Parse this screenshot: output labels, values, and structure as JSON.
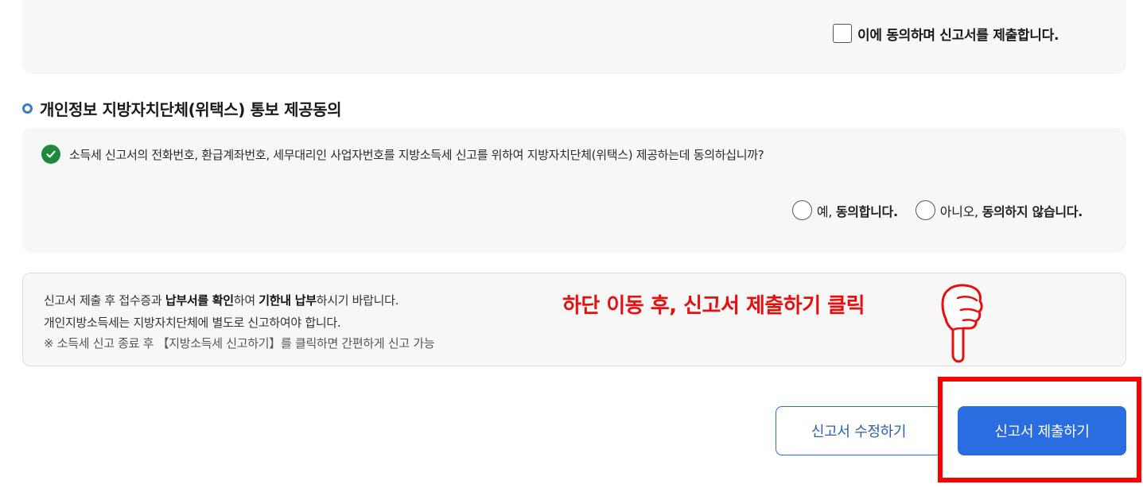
{
  "agreement": {
    "submit_consent_label": "이에 동의하며 신고서를 제출합니다."
  },
  "consent_section": {
    "title": "개인정보 지방자치단체(위택스) 통보 제공동의",
    "question": "소득세 신고서의 전화번호, 환급계좌번호, 세무대리인 사업자번호를 지방소득세 신고를 위하여 지방자치단체(위택스) 제공하는데 동의하십니까?",
    "yes_prefix": "예, ",
    "yes_bold": "동의합니다.",
    "no_prefix": "아니오, ",
    "no_bold": "동의하지 않습니다."
  },
  "notice": {
    "line1_a": "신고서 제출 후 접수증과 ",
    "line1_b": "납부서를 확인",
    "line1_c": "하여 ",
    "line1_d": "기한내 납부",
    "line1_e": "하시기 바랍니다.",
    "line2": "개인지방소득세는 지방자치단체에 별도로 신고하여야 합니다.",
    "line3": "※ 소득세 신고 종료 후 【지방소득세 신고하기】를 클릭하면 간편하게 신고 가능"
  },
  "annotation": {
    "instruction": "하단 이동 후, 신고서 제출하기 클릭",
    "hand_icon": "pointing-hand-down-icon",
    "highlight_color": "#ff0000"
  },
  "actions": {
    "edit_label": "신고서 수정하기",
    "submit_label": "신고서 제출하기"
  },
  "colors": {
    "accent": "#2a6de0",
    "check_green": "#1e8a3c",
    "annotation_red": "#e8100f"
  }
}
